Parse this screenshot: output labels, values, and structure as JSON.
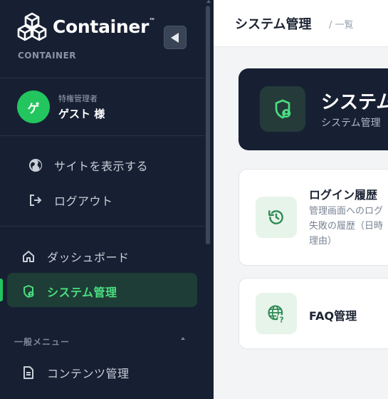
{
  "sidebar": {
    "brand_name": "Container",
    "brand_tm": "™",
    "brand_sub": "CONTAINER",
    "collapse_icon": "triangle-left-icon",
    "user": {
      "avatar_text": "ゲ",
      "role": "特権管理者",
      "name": "ゲスト 様"
    },
    "items": [
      {
        "label": "サイトを表示する",
        "icon": "globe-icon"
      },
      {
        "label": "ログアウト",
        "icon": "logout-icon"
      },
      {
        "label": "ダッシュボード",
        "icon": "home-icon"
      },
      {
        "label": "システム管理",
        "icon": "shield-user-icon",
        "active": true
      },
      {
        "label": "コンテンツ管理",
        "icon": "document-icon"
      }
    ],
    "section_label": "一般メニュー"
  },
  "header": {
    "title": "システム管理",
    "breadcrumb": "/ 一覧"
  },
  "hero": {
    "title": "システム管理",
    "subtitle": "システム管理"
  },
  "cards": [
    {
      "title": "ログイン履歴",
      "desc_lines": [
        "管理画面へのログ",
        "失敗の履歴（日時",
        "理由）"
      ],
      "icon": "history-icon"
    },
    {
      "title": "FAQ管理",
      "icon": "globe-question-icon"
    }
  ],
  "colors": {
    "sidebar_bg": "#172033",
    "accent": "#22c55e",
    "active_bg": "#1e3d36"
  }
}
